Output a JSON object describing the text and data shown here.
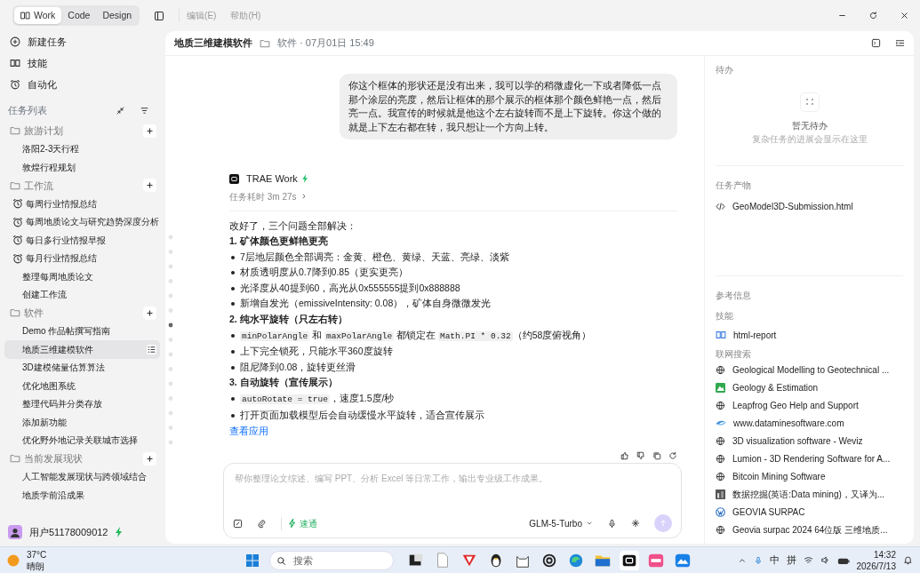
{
  "mode_tabs": [
    {
      "label": "Work",
      "selected": true
    },
    {
      "label": "Code",
      "selected": false
    },
    {
      "label": "Design",
      "selected": false
    }
  ],
  "menu": [
    "编辑(E)",
    "帮助(H)"
  ],
  "sidebar": {
    "nav": [
      {
        "label": "新建任务",
        "kind": "new"
      },
      {
        "label": "技能",
        "kind": "skill"
      },
      {
        "label": "自动化",
        "kind": "automation"
      }
    ],
    "task_list_title": "任务列表",
    "groups": [
      {
        "label": "旅游计划",
        "children": [
          {
            "label": "洛阳2-3天行程",
            "kind": "task",
            "selected": false
          },
          {
            "label": "敦煌行程规划",
            "kind": "task",
            "selected": false
          }
        ]
      },
      {
        "label": "工作流",
        "children": [
          {
            "label": "每周行业情报总结",
            "kind": "scheduled",
            "selected": false
          },
          {
            "label": "每周地质论文与研究趋势深度分析",
            "kind": "scheduled",
            "selected": false
          },
          {
            "label": "每日多行业情报早报",
            "kind": "scheduled",
            "selected": false
          },
          {
            "label": "每月行业情报总结",
            "kind": "scheduled",
            "selected": false
          },
          {
            "label": "整理每周地质论文",
            "kind": "task",
            "selected": false
          },
          {
            "label": "创建工作流",
            "kind": "task",
            "selected": false
          }
        ]
      },
      {
        "label": "软件",
        "children": [
          {
            "label": "Demo 作品帖撰写指南",
            "kind": "task",
            "selected": false
          },
          {
            "label": "地质三维建模软件",
            "kind": "task",
            "selected": true
          },
          {
            "label": "3D建模储量估算算法",
            "kind": "task",
            "selected": false
          },
          {
            "label": "优化地图系统",
            "kind": "task",
            "selected": false
          },
          {
            "label": "整理代码并分类存放",
            "kind": "task",
            "selected": false
          },
          {
            "label": "添加新功能",
            "kind": "task",
            "selected": false
          },
          {
            "label": "优化野外地记录关联城市选择",
            "kind": "task",
            "selected": false
          }
        ]
      },
      {
        "label": "当前发展现状",
        "children": [
          {
            "label": "人工智能发展现状与跨领域结合",
            "kind": "task",
            "selected": false
          },
          {
            "label": "地质学前沿成果",
            "kind": "task",
            "selected": false
          }
        ]
      }
    ],
    "user": {
      "name": "用户51178009012"
    }
  },
  "task": {
    "title": "地质三维建模软件",
    "meta": "软件 · 07月01日 15:49"
  },
  "chat": {
    "user_message": "你这个框体的形状还是没有出来，我可以学的稍微虚化一下或者降低一点那个涂层的亮度，然后让框体的那个展示的框体那个颜色鲜艳一点，然后亮一点。我宣传的时候就是他这个左右旋转而不是上下旋转。你这个做的就是上下左右都在转，我只想让一个方向上转。",
    "assistant": {
      "name": "TRAE Work",
      "duration": "任务耗时 3m 27s",
      "blocks": [
        {
          "kind": "paragraph",
          "parts": [
            {
              "kind": "text",
              "text": "改好了，三个问题全部解决："
            }
          ]
        },
        {
          "kind": "heading",
          "parts": [
            {
              "kind": "text",
              "text": "1. 矿体颜色更鲜艳更亮"
            }
          ]
        },
        {
          "kind": "bullet",
          "parts": [
            {
              "kind": "text",
              "text": "7层地层颜色全部调亮：金黄、橙色、黄绿、天蓝、亮绿、淡紫"
            }
          ]
        },
        {
          "kind": "bullet",
          "parts": [
            {
              "kind": "text",
              "text": "材质透明度从0.7降到0.85（更实更亮）"
            }
          ]
        },
        {
          "kind": "bullet",
          "parts": [
            {
              "kind": "text",
              "text": "光泽度从40提到60，高光从0x555555提到0x888888"
            }
          ]
        },
        {
          "kind": "bullet",
          "parts": [
            {
              "kind": "text",
              "text": "新增自发光（emissiveIntensity: 0.08），矿体自身微微发光"
            }
          ]
        },
        {
          "kind": "heading",
          "parts": [
            {
              "kind": "text",
              "text": "2. 纯水平旋转（只左右转）"
            }
          ]
        },
        {
          "kind": "bullet",
          "parts": [
            {
              "kind": "code",
              "text": "minPolarAngle"
            },
            {
              "kind": "text",
              "text": " 和 "
            },
            {
              "kind": "code",
              "text": "maxPolarAngle"
            },
            {
              "kind": "text",
              "text": " 都锁定在 "
            },
            {
              "kind": "code",
              "text": "Math.PI * 0.32"
            },
            {
              "kind": "text",
              "text": "（约58度俯视角）"
            }
          ]
        },
        {
          "kind": "bullet",
          "parts": [
            {
              "kind": "text",
              "text": "上下完全锁死，只能水平360度旋转"
            }
          ]
        },
        {
          "kind": "bullet",
          "parts": [
            {
              "kind": "text",
              "text": "阻尼降到0.08，旋转更丝滑"
            }
          ]
        },
        {
          "kind": "heading",
          "parts": [
            {
              "kind": "text",
              "text": "3. 自动旋转（宣传展示）"
            }
          ]
        },
        {
          "kind": "bullet",
          "parts": [
            {
              "kind": "code",
              "text": "autoRotate = true"
            },
            {
              "kind": "text",
              "text": "，速度1.5度/秒"
            }
          ]
        },
        {
          "kind": "bullet",
          "parts": [
            {
              "kind": "text",
              "text": "打开页面加载模型后会自动缓慢水平旋转，适合宣传展示"
            }
          ]
        }
      ],
      "link": "查看应用"
    }
  },
  "composer": {
    "placeholder": "帮你整理论文综述、编写 PPT、分析 Excel 等日常工作，输出专业级工作成果。",
    "speed_label": "速通",
    "model": "GLM-5-Turbo"
  },
  "panel": {
    "todo": {
      "title": "待办",
      "empty_title": "暂无待办",
      "empty_hint": "复杂任务的进展会显示在这里"
    },
    "outputs": {
      "title": "任务产物",
      "files": [
        "GeoModel3D-Submission.html"
      ]
    },
    "references": {
      "title": "参考信息",
      "skills_title": "技能",
      "skills": [
        "html-report"
      ],
      "search_title": "联网搜索",
      "results": [
        {
          "title": "Geological Modelling to Geotechnical ...",
          "kind": "globe"
        },
        {
          "title": "Geology & Estimation",
          "kind": "green"
        },
        {
          "title": "Leapfrog Geo Help and Support",
          "kind": "globe"
        },
        {
          "title": "www.dataminesoftware.com",
          "kind": "blue"
        },
        {
          "title": "3D visualization software - Weviz",
          "kind": "globe"
        },
        {
          "title": "Lumion - 3D Rendering Software for A...",
          "kind": "globe"
        },
        {
          "title": "Bitcoin Mining Software",
          "kind": "globe"
        },
        {
          "title": "数据挖掘(英语:Data mining)，又译为...",
          "kind": "dark"
        },
        {
          "title": "GEOVIA SURPAC",
          "kind": "wordpress"
        },
        {
          "title": "Geovia surpac 2024 64位版 三维地质...",
          "kind": "globe"
        }
      ]
    }
  },
  "taskbar": {
    "temperature": "37°C",
    "condition": "晴朗",
    "search_placeholder": "搜索",
    "ime": [
      "中",
      "拼"
    ],
    "time": "14:32",
    "date": "2026/7/13"
  }
}
